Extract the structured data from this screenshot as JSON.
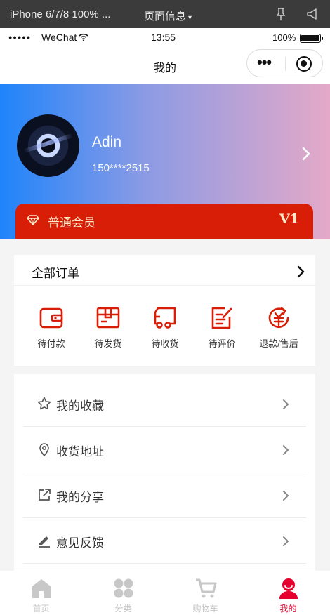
{
  "devtools": {
    "device": "iPhone 6/7/8 100% ...",
    "page_info": "页面信息",
    "pin_icon": "pin-icon",
    "volume_icon": "volume-icon"
  },
  "status_bar": {
    "carrier": "WeChat",
    "time": "13:55",
    "battery": "100%"
  },
  "nav": {
    "title": "我的"
  },
  "profile": {
    "name": "Adin",
    "phone": "150****2515",
    "member_label": "普通会员",
    "member_level": "V1"
  },
  "orders": {
    "title": "全部订单",
    "items": [
      {
        "label": "待付款",
        "icon": "wallet-icon"
      },
      {
        "label": "待发货",
        "icon": "package-icon"
      },
      {
        "label": "待收货",
        "icon": "truck-icon"
      },
      {
        "label": "待评价",
        "icon": "edit-review-icon"
      },
      {
        "label": "退款/售后",
        "icon": "refund-icon"
      }
    ]
  },
  "menu": {
    "items": [
      {
        "label": "我的收藏",
        "icon": "star-icon"
      },
      {
        "label": "收货地址",
        "icon": "location-icon"
      },
      {
        "label": "我的分享",
        "icon": "share-icon"
      },
      {
        "label": "意见反馈",
        "icon": "pen-icon"
      }
    ]
  },
  "tabbar": {
    "items": [
      {
        "label": "首页",
        "icon": "home-icon"
      },
      {
        "label": "分类",
        "icon": "category-icon"
      },
      {
        "label": "购物车",
        "icon": "cart-icon"
      },
      {
        "label": "我的",
        "icon": "user-icon",
        "active": true
      }
    ]
  },
  "colors": {
    "accent": "#d81e06",
    "tab_active": "#e6002e",
    "gradient_start": "#1f84fb",
    "gradient_end": "#e4a9c8"
  }
}
